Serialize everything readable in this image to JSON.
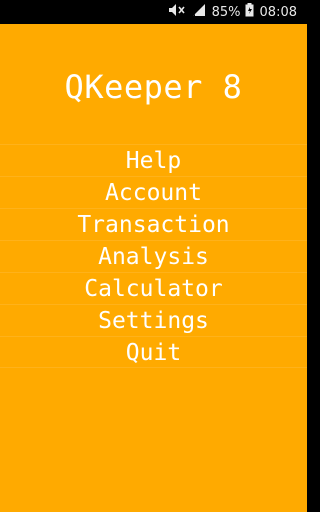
{
  "status_bar": {
    "battery_percent": "85%",
    "time": "08:08",
    "icons": [
      "mute-icon",
      "signal-icon",
      "battery-icon"
    ]
  },
  "app": {
    "title": "QKeeper 8",
    "background_color": "#ffaa00",
    "text_color": "#ffffff"
  },
  "menu": {
    "items": [
      {
        "label": "Help"
      },
      {
        "label": "Account"
      },
      {
        "label": "Transaction"
      },
      {
        "label": "Analysis"
      },
      {
        "label": "Calculator"
      },
      {
        "label": "Settings"
      },
      {
        "label": "Quit"
      }
    ]
  }
}
